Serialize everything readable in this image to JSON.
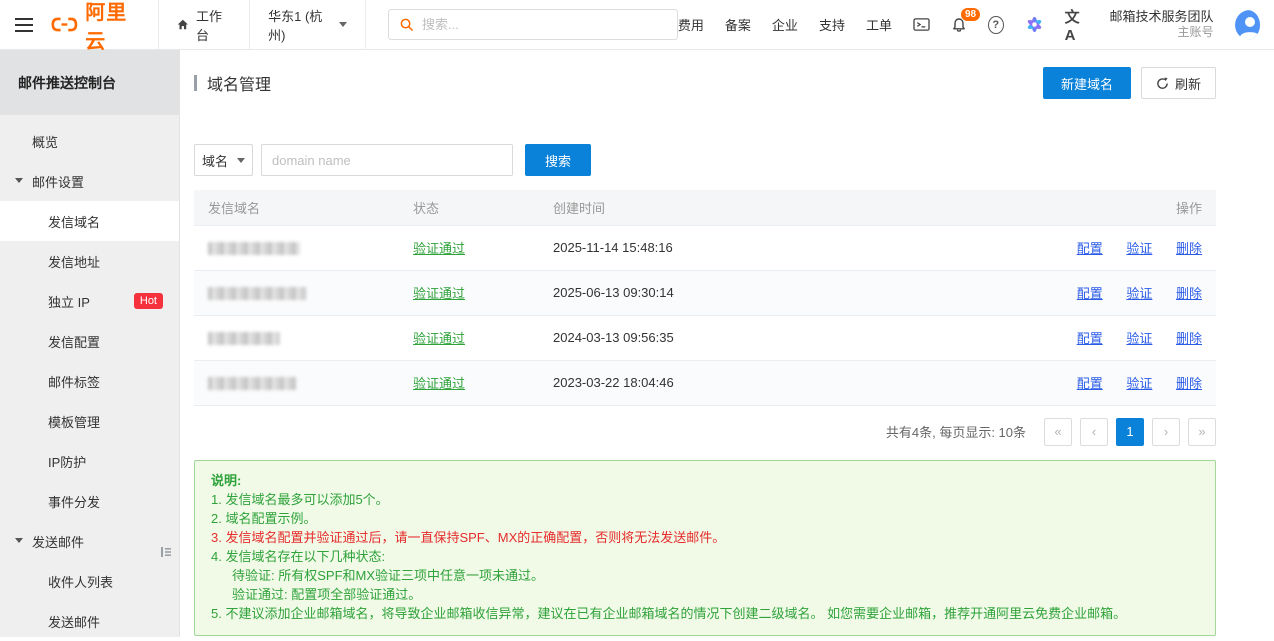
{
  "colors": {
    "brand_orange": "#ff6a00",
    "primary_blue": "#0b82d9",
    "link_blue": "#2b5ce8",
    "success_green": "#2fa23a",
    "danger_red": "#e62c2c",
    "hot_badge_red": "#f5313d",
    "notice_bg": "#f0fae7",
    "notice_border": "#a2d79a"
  },
  "topbar": {
    "logo": "阿里云",
    "workbench": "工作台",
    "region": "华东1 (杭州)",
    "search_placeholder": "搜索...",
    "menu": [
      "费用",
      "备案",
      "企业",
      "支持",
      "工单"
    ],
    "notification_count": "98",
    "help_glyph": "?",
    "translate_text": "文A",
    "account": {
      "team": "邮箱技术服务团队",
      "role": "主账号"
    }
  },
  "sidebar": {
    "title": "邮件推送控制台",
    "items": [
      {
        "label": "概览",
        "type": "item"
      },
      {
        "label": "邮件设置",
        "type": "group"
      },
      {
        "label": "发信域名",
        "type": "sub",
        "active": true
      },
      {
        "label": "发信地址",
        "type": "sub"
      },
      {
        "label": "独立 IP",
        "type": "sub",
        "badge": "Hot"
      },
      {
        "label": "发信配置",
        "type": "sub"
      },
      {
        "label": "邮件标签",
        "type": "sub"
      },
      {
        "label": "模板管理",
        "type": "sub"
      },
      {
        "label": "IP防护",
        "type": "sub"
      },
      {
        "label": "事件分发",
        "type": "sub"
      },
      {
        "label": "发送邮件",
        "type": "group"
      },
      {
        "label": "收件人列表",
        "type": "sub"
      },
      {
        "label": "发送邮件",
        "type": "sub"
      }
    ]
  },
  "page": {
    "title": "域名管理",
    "actions": {
      "new_domain": "新建域名",
      "refresh": "刷新"
    },
    "filter": {
      "field": "域名",
      "placeholder": "domain name",
      "search": "搜索"
    },
    "table": {
      "headers": [
        "发信域名",
        "状态",
        "创建时间",
        "操作"
      ],
      "row_actions": [
        "配置",
        "验证",
        "删除"
      ],
      "rows": [
        {
          "domain_redacted": true,
          "status": "验证通过",
          "created": "2025-11-14 15:48:16"
        },
        {
          "domain_redacted": true,
          "status": "验证通过",
          "created": "2025-06-13 09:30:14"
        },
        {
          "domain_redacted": true,
          "status": "验证通过",
          "created": "2024-03-13 09:56:35"
        },
        {
          "domain_redacted": true,
          "status": "验证通过",
          "created": "2023-03-22 18:04:46"
        }
      ]
    },
    "pagination": {
      "summary": "共有4条, 每页显示: 10条",
      "first": "«",
      "prev": "‹",
      "current": "1",
      "next": "›",
      "last": "»"
    },
    "notice": {
      "title": "说明:",
      "lines": [
        {
          "text": "1. 发信域名最多可以添加5个。",
          "style": "green"
        },
        {
          "text": "2. 域名配置示例。",
          "style": "green"
        },
        {
          "text": "3. 发信域名配置并验证通过后，请一直保持SPF、MX的正确配置，否则将无法发送邮件。",
          "style": "red"
        },
        {
          "text": "4. 发信域名存在以下几种状态:",
          "style": "green"
        },
        {
          "text": "待验证: 所有权SPF和MX验证三项中任意一项未通过。",
          "style": "green-indent"
        },
        {
          "text": "验证通过: 配置项全部验证通过。",
          "style": "green-indent"
        },
        {
          "text": "5. 不建议添加企业邮箱域名，将导致企业邮箱收信异常，建议在已有企业邮箱域名的情况下创建二级域名。 如您需要企业邮箱，推荐开通阿里云免费企业邮箱。",
          "style": "green"
        }
      ]
    }
  }
}
